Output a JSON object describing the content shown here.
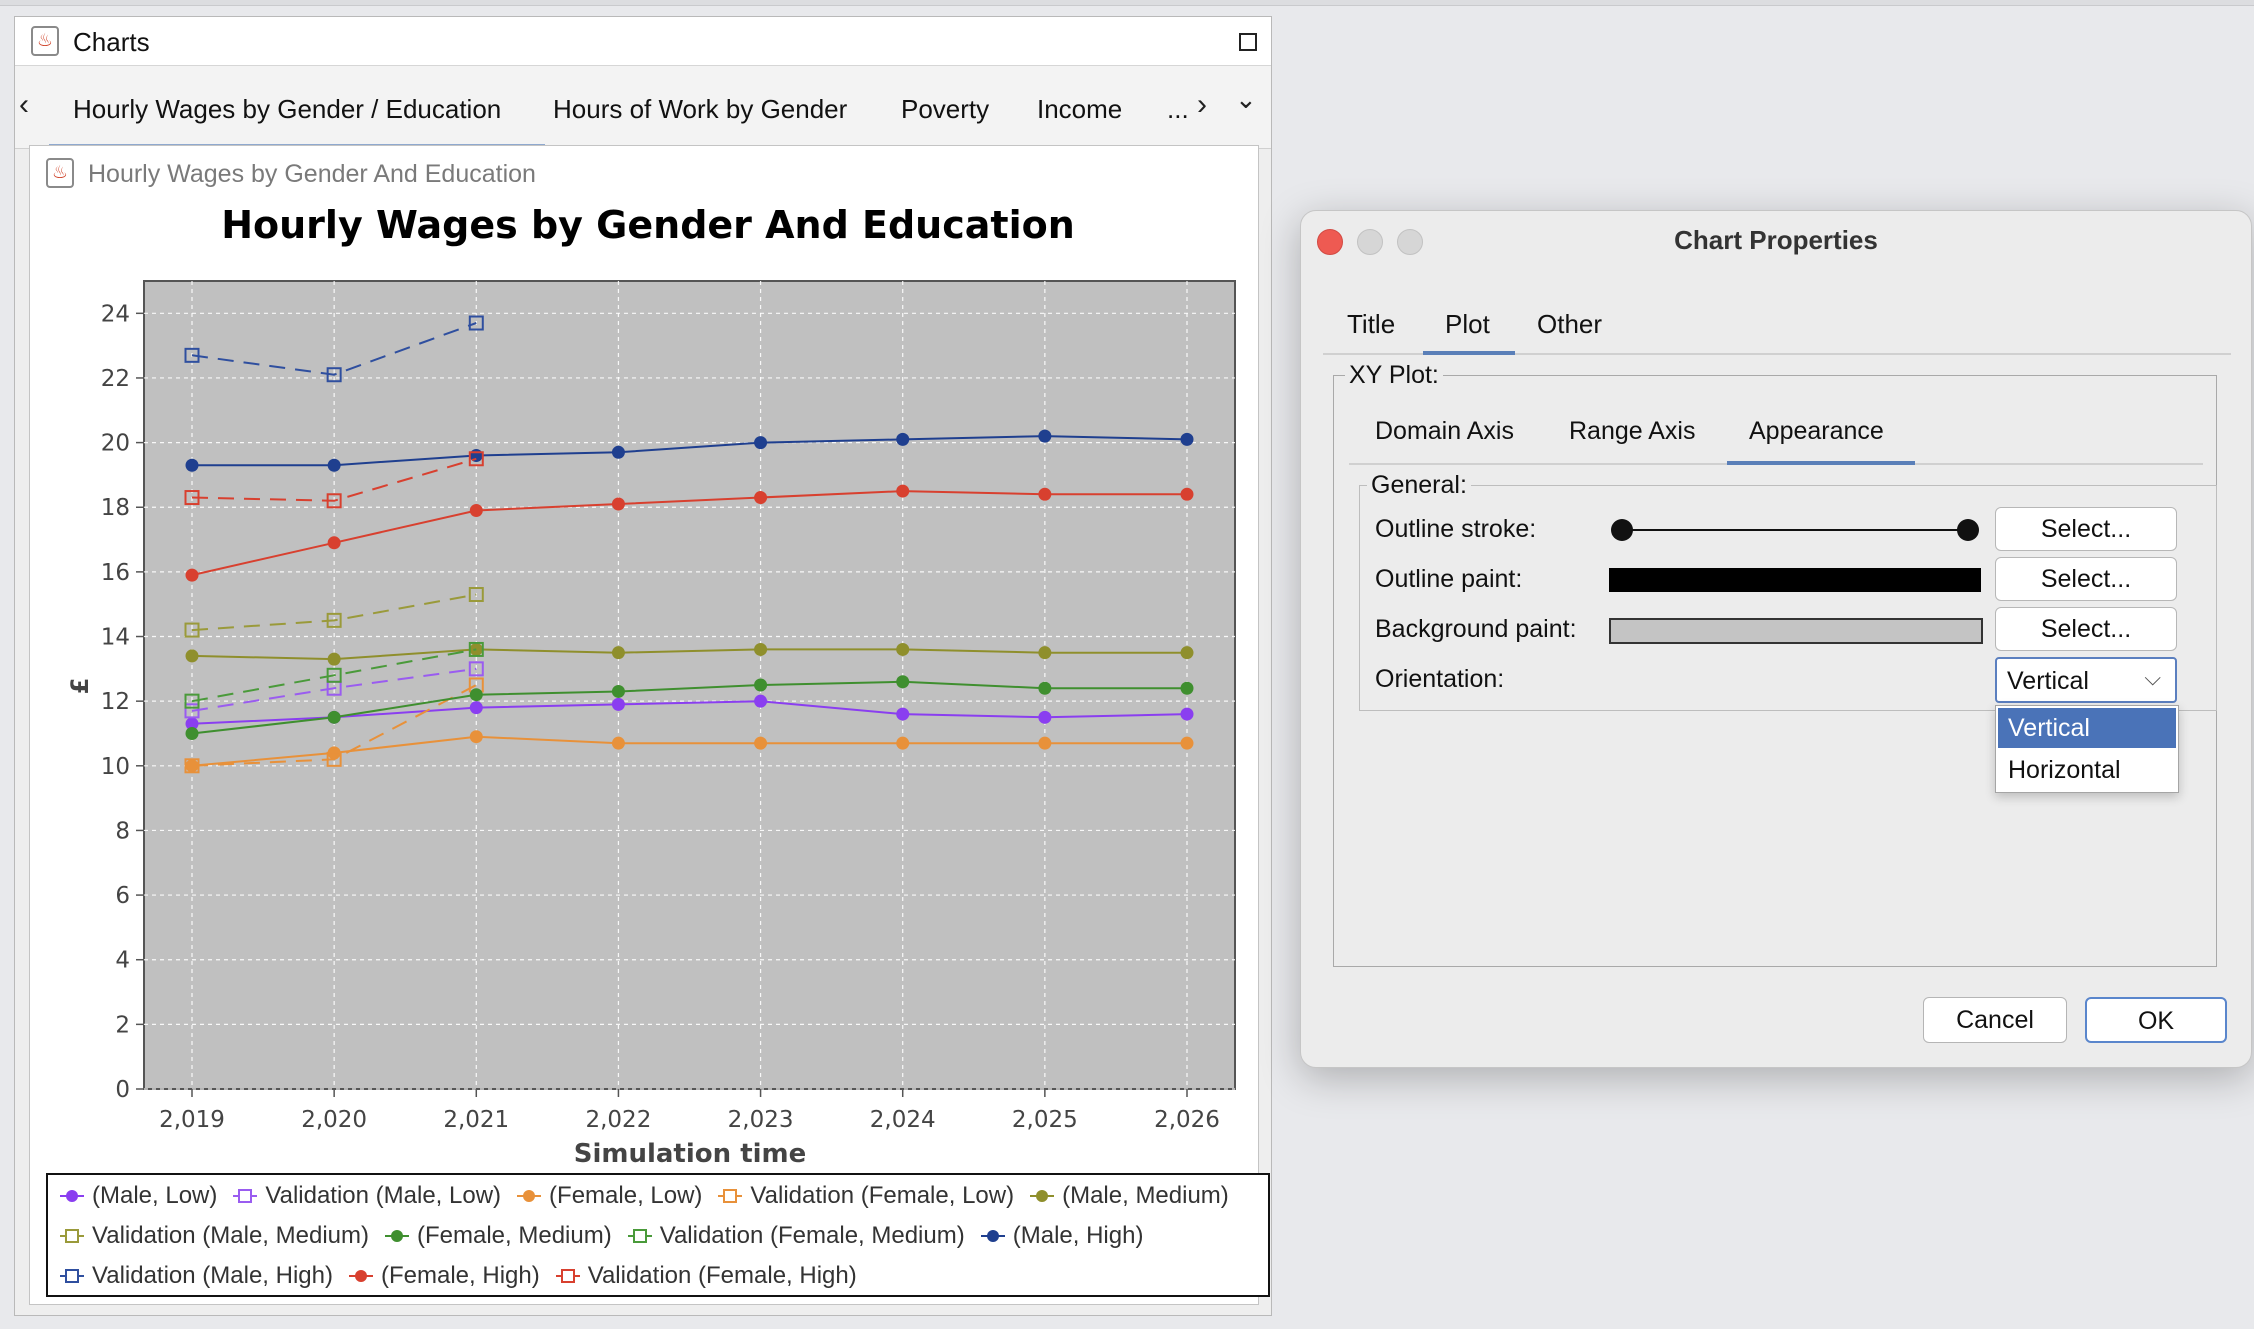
{
  "charts_window": {
    "title": "Charts",
    "tabs": [
      {
        "label": "Hourly Wages by Gender / Education",
        "active": true
      },
      {
        "label": "Hours of Work by Gender"
      },
      {
        "label": "Poverty"
      },
      {
        "label": "Income"
      }
    ],
    "more_label": "...",
    "frame_title": "Hourly Wages by Gender And Education"
  },
  "chart_data": {
    "type": "line",
    "title": "Hourly Wages by Gender And Education",
    "xlabel": "Simulation time",
    "ylabel": "£",
    "x": [
      2019,
      2020,
      2021,
      2022,
      2023,
      2024,
      2025,
      2026
    ],
    "x_tick_labels": [
      "2,019",
      "2,020",
      "2,021",
      "2,022",
      "2,023",
      "2,024",
      "2,025",
      "2,026"
    ],
    "ylim": [
      0,
      25
    ],
    "yticks": [
      0,
      2,
      4,
      6,
      8,
      10,
      12,
      14,
      16,
      18,
      20,
      22,
      24
    ],
    "grid": true,
    "background": "#c0c0c0",
    "legend_position": "bottom",
    "series": [
      {
        "name": "(Male, Low)",
        "color": "#8a3ef0",
        "style": "solid",
        "marker": "circle",
        "values": [
          11.3,
          11.5,
          11.8,
          11.9,
          12.0,
          11.6,
          11.5,
          11.6
        ]
      },
      {
        "name": "Validation (Male, Low)",
        "color": "#9a5cf0",
        "style": "dashed",
        "marker": "square",
        "values": [
          11.7,
          12.4,
          13.0,
          null,
          null,
          null,
          null,
          null
        ]
      },
      {
        "name": "(Female, Low)",
        "color": "#e8913a",
        "style": "solid",
        "marker": "circle",
        "values": [
          10.0,
          10.4,
          10.9,
          10.7,
          10.7,
          10.7,
          10.7,
          10.7
        ]
      },
      {
        "name": "Validation (Female, Low)",
        "color": "#e8913a",
        "style": "dashed",
        "marker": "square",
        "values": [
          10.0,
          10.2,
          12.5,
          null,
          null,
          null,
          null,
          null
        ]
      },
      {
        "name": "(Male, Medium)",
        "color": "#8f8f2c",
        "style": "solid",
        "marker": "circle",
        "values": [
          13.4,
          13.3,
          13.6,
          13.5,
          13.6,
          13.6,
          13.5,
          13.5
        ]
      },
      {
        "name": "Validation (Male, Medium)",
        "color": "#9a9a3a",
        "style": "dashed",
        "marker": "square",
        "values": [
          14.2,
          14.5,
          15.3,
          null,
          null,
          null,
          null,
          null
        ]
      },
      {
        "name": "(Female, Medium)",
        "color": "#3f8f2f",
        "style": "solid",
        "marker": "circle",
        "values": [
          11.0,
          11.5,
          12.2,
          12.3,
          12.5,
          12.6,
          12.4,
          12.4
        ]
      },
      {
        "name": "Validation (Female, Medium)",
        "color": "#4a9a3a",
        "style": "dashed",
        "marker": "square",
        "values": [
          12.0,
          12.8,
          13.6,
          null,
          null,
          null,
          null,
          null
        ]
      },
      {
        "name": "(Male, High)",
        "color": "#1f3f8f",
        "style": "solid",
        "marker": "circle",
        "values": [
          19.3,
          19.3,
          19.6,
          19.7,
          20.0,
          20.1,
          20.2,
          20.1
        ]
      },
      {
        "name": "Validation (Male, High)",
        "color": "#2f4f9f",
        "style": "dashed",
        "marker": "square",
        "values": [
          22.7,
          22.1,
          23.7,
          null,
          null,
          null,
          null,
          null
        ]
      },
      {
        "name": "(Female, High)",
        "color": "#d8402f",
        "style": "solid",
        "marker": "circle",
        "values": [
          15.9,
          16.9,
          17.9,
          18.1,
          18.3,
          18.5,
          18.4,
          18.4
        ]
      },
      {
        "name": "Validation (Female, High)",
        "color": "#d8402f",
        "style": "dashed",
        "marker": "square",
        "values": [
          18.3,
          18.2,
          19.5,
          null,
          null,
          null,
          null,
          null
        ]
      }
    ]
  },
  "dialog": {
    "title": "Chart Properties",
    "tabs": [
      "Title",
      "Plot",
      "Other"
    ],
    "active_tab": "Plot",
    "group_label": "XY Plot:",
    "subtabs": [
      "Domain Axis",
      "Range Axis",
      "Appearance"
    ],
    "active_subtab": "Appearance",
    "general_label": "General:",
    "outline_stroke_label": "Outline stroke:",
    "outline_paint_label": "Outline paint:",
    "background_paint_label": "Background paint:",
    "orientation_label": "Orientation:",
    "select_label": "Select...",
    "orientation_value": "Vertical",
    "orientation_options": [
      "Vertical",
      "Horizontal"
    ],
    "outline_paint_color": "#000000",
    "background_paint_color": "#c4c4c4",
    "cancel_label": "Cancel",
    "ok_label": "OK"
  }
}
